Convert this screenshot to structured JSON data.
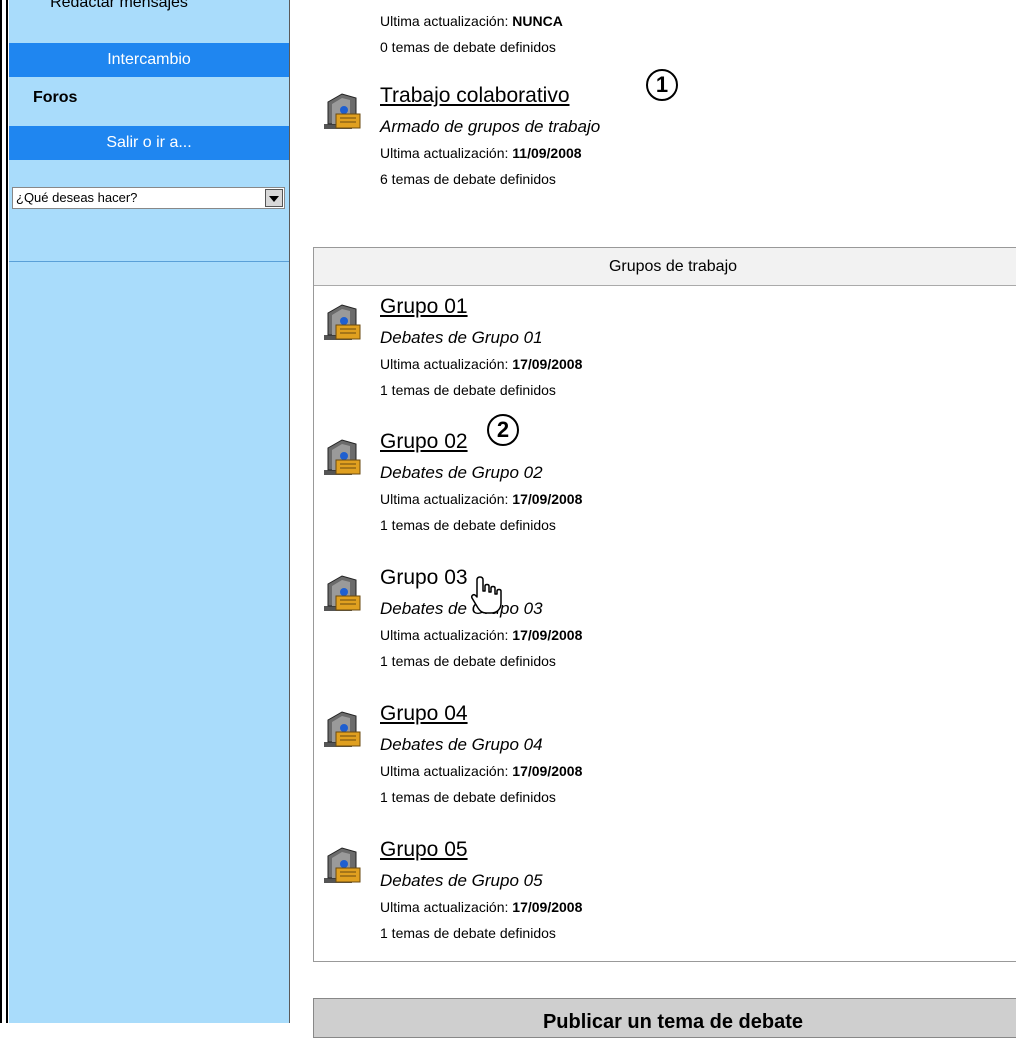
{
  "sidebar": {
    "compose_label": "Redactar mensajes",
    "exchange_label": "Intercambio",
    "forums_label": "Foros",
    "exit_label": "Salir o ir a...",
    "action_select_value": "¿Qué deseas hacer?"
  },
  "top_forum": {
    "update_label": "Ultima actualización:",
    "update_value": "NUNCA",
    "topics": "0 temas de debate definidos"
  },
  "collab_forum": {
    "title": "Trabajo colaborativo",
    "description": "Armado de grupos de trabajo",
    "update_label": "Ultima actualización:",
    "update_value": "11/09/2008",
    "topics": "6 temas de debate definidos"
  },
  "groups_section": {
    "header": "Grupos de trabajo",
    "groups": [
      {
        "title": "Grupo 01",
        "description": "Debates de Grupo 01",
        "update_label": "Ultima actualización:",
        "update_value": "17/09/2008",
        "topics": "1 temas de debate definidos"
      },
      {
        "title": "Grupo 02",
        "description": "Debates de Grupo 02",
        "update_label": "Ultima actualización:",
        "update_value": "17/09/2008",
        "topics": "1 temas de debate definidos"
      },
      {
        "title": "Grupo 03",
        "description": "Debates de Grupo 03",
        "update_label": "Ultima actualización:",
        "update_value": "17/09/2008",
        "topics": "1 temas de debate definidos"
      },
      {
        "title": "Grupo 04",
        "description": "Debates de Grupo 04",
        "update_label": "Ultima actualización:",
        "update_value": "17/09/2008",
        "topics": "1 temas de debate definidos"
      },
      {
        "title": "Grupo 05",
        "description": "Debates de Grupo 05",
        "update_label": "Ultima actualización:",
        "update_value": "17/09/2008",
        "topics": "1 temas de debate definidos"
      }
    ]
  },
  "publish_section": {
    "label": "Publicar un tema de debate"
  },
  "callouts": [
    "1",
    "2"
  ],
  "colors": {
    "sidebar_bg": "#a9dcfb",
    "sidebar_button": "#1f86f0"
  }
}
